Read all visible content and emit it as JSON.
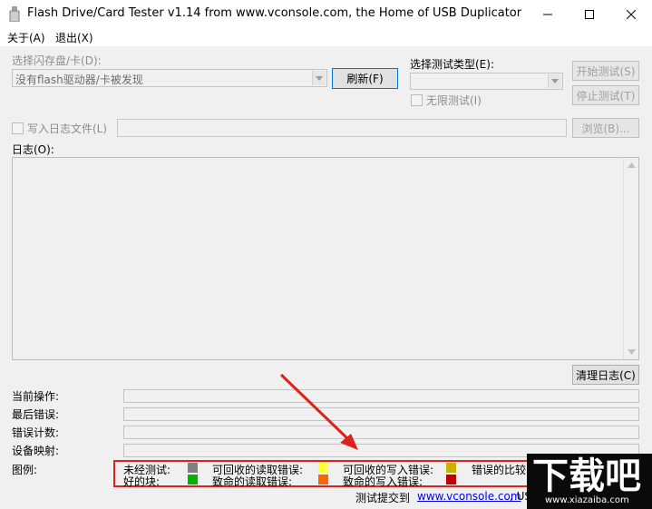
{
  "window": {
    "title": "Flash Drive/Card Tester v1.14 from www.vconsole.com, the Home of USB Duplicator"
  },
  "menu": {
    "about": "关于(A)",
    "exit": "退出(X)"
  },
  "drive_select": {
    "label": "选择闪存盘/卡(D):",
    "value": "没有flash驱动器/卡被发现",
    "refresh_label": "刷新(F)"
  },
  "test_type": {
    "label": "选择测试类型(E):",
    "value": "",
    "infinite_label": "无限测试(I)"
  },
  "actions": {
    "start_label": "开始测试(S)",
    "stop_label": "停止测试(T)",
    "browse_label": "浏览(B)..."
  },
  "logfile": {
    "label": "写入日志文件(L)",
    "value": ""
  },
  "log": {
    "label": "日志(O):",
    "clear_label": "清理日志(C)"
  },
  "status": {
    "current_op_label": "当前操作:",
    "last_error_label": "最后错误:",
    "error_count_label": "错误计数:",
    "device_map_label": "设备映射:"
  },
  "legend": {
    "label": "图例:",
    "items": [
      {
        "label": "未经测试:",
        "color": "#808080"
      },
      {
        "label": "可回收的读取错误:",
        "color": "#ffff40"
      },
      {
        "label": "可回收的写入错误:",
        "color": "#c8b400"
      },
      {
        "label": "错误的比较",
        "color": ""
      },
      {
        "label": "好的块:",
        "color": "#00b400"
      },
      {
        "label": "致命的读取错误:",
        "color": "#ff6400"
      },
      {
        "label": "致命的写入错误:",
        "color": "#c00000"
      }
    ]
  },
  "footer": {
    "prefix": "测试提交到",
    "link": "www.vconsole.com",
    "suffix": ", US"
  },
  "watermark": {
    "text": "下载吧",
    "url": "www.xiazaiba.com"
  },
  "annotation": {
    "arrow_color": "#e0201b",
    "box_color": "#e0201b"
  }
}
